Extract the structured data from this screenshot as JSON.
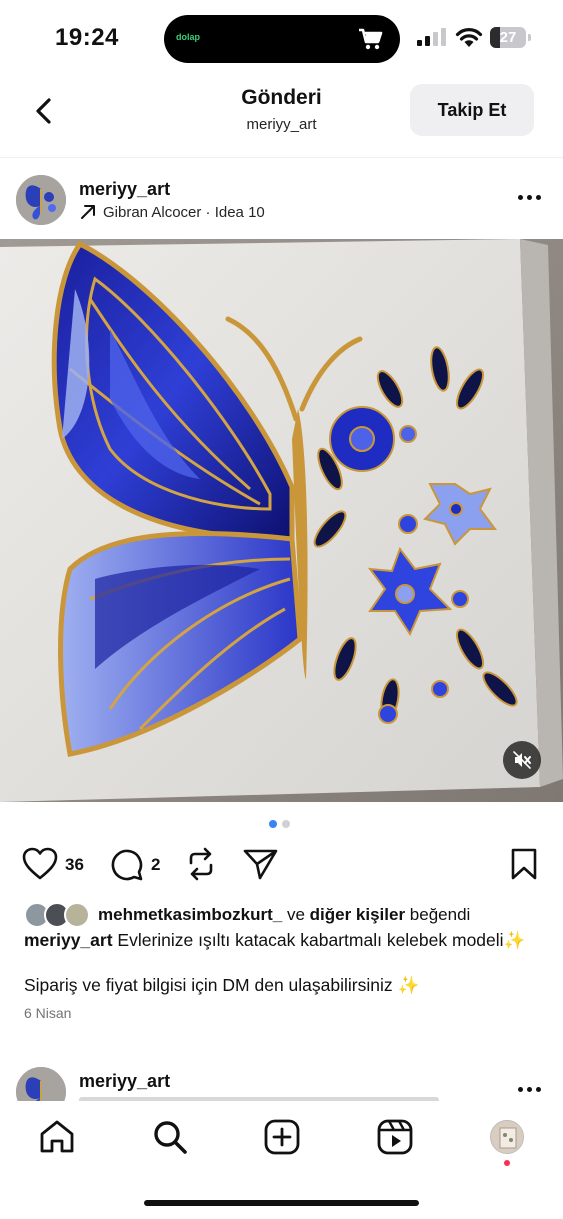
{
  "status_bar": {
    "time": "19:24",
    "island_app": "dolap",
    "battery": "27",
    "battery_level": 0.27
  },
  "nav": {
    "title": "Gönderi",
    "subtitle": "meriyy_art",
    "follow_label": "Takip Et"
  },
  "post": {
    "username": "meriyy_art",
    "audio": "Gibran Alcocer · Idea 10",
    "media_slides": 2,
    "media_active_index": 0,
    "like_count": "36",
    "comment_count": "2",
    "likes": {
      "user": "mehmetkasimbozkurt_",
      "connector": " ve ",
      "others": "diğer kişiler",
      "suffix": " beğendi"
    },
    "caption_user": "meriyy_art",
    "caption_text": " Evlerinize ışıltı katacak kabartmalı kelebek modeli✨",
    "caption_line2": "Sipariş ve fiyat bilgisi için DM den ulaşabilirsiniz ✨",
    "date": "6 Nisan"
  },
  "next_post": {
    "username": "meriyy_art"
  },
  "icons": {
    "back": "chevron-left-icon",
    "audio": "arrow-up-right-icon",
    "more": "more-horizontal-icon",
    "mute": "speaker-muted-icon",
    "like": "heart-icon",
    "comment": "comment-bubble-icon",
    "repost": "repost-icon",
    "share": "paper-plane-icon",
    "save": "bookmark-icon",
    "home": "home-icon",
    "search": "search-icon",
    "create": "plus-square-icon",
    "reels": "reels-icon"
  },
  "colors": {
    "accent_blue": "#3b82f6",
    "follow_bg": "#efeff1",
    "notification": "#ff2d55",
    "island_app": "#39d17a"
  }
}
